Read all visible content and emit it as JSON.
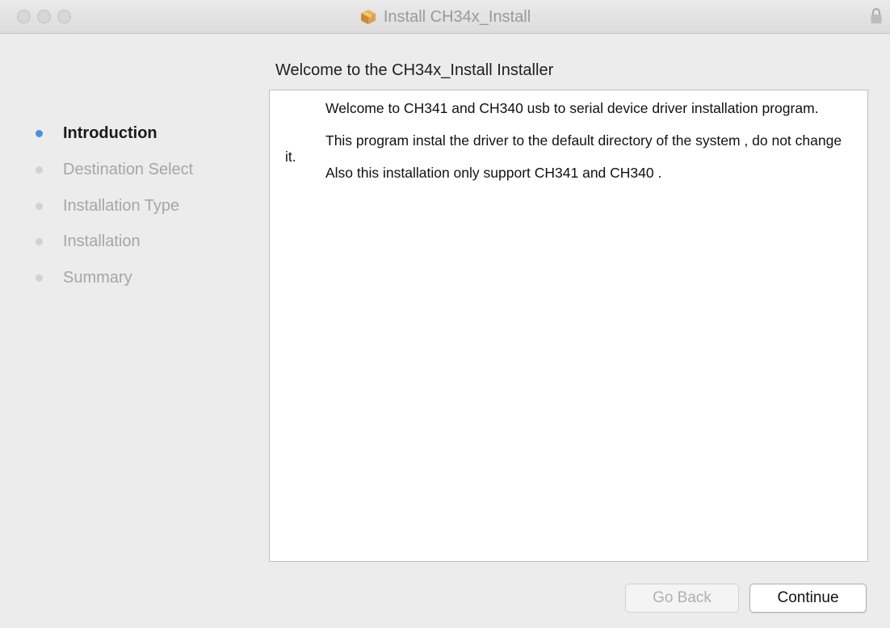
{
  "window": {
    "title": "Install CH34x_Install",
    "title_icon": "package-icon",
    "lock_icon": "lock-icon"
  },
  "sidebar": {
    "steps": [
      {
        "label": "Introduction",
        "active": true
      },
      {
        "label": "Destination Select",
        "active": false
      },
      {
        "label": "Installation Type",
        "active": false
      },
      {
        "label": "Installation",
        "active": false
      },
      {
        "label": "Summary",
        "active": false
      }
    ]
  },
  "main": {
    "heading": "Welcome to the CH34x_Install Installer",
    "paragraphs": [
      "Welcome to CH341 and CH340 usb to serial device driver installation program.",
      "This program instal the driver to the default directory of the system , do not change it.",
      "Also this installation only support CH341 and CH340 ."
    ]
  },
  "buttons": {
    "back_label": "Go Back",
    "continue_label": "Continue"
  },
  "colors": {
    "active_dot": "#4a90e2",
    "inactive_dot": "#d2d2d2",
    "window_bg": "#ececec"
  }
}
